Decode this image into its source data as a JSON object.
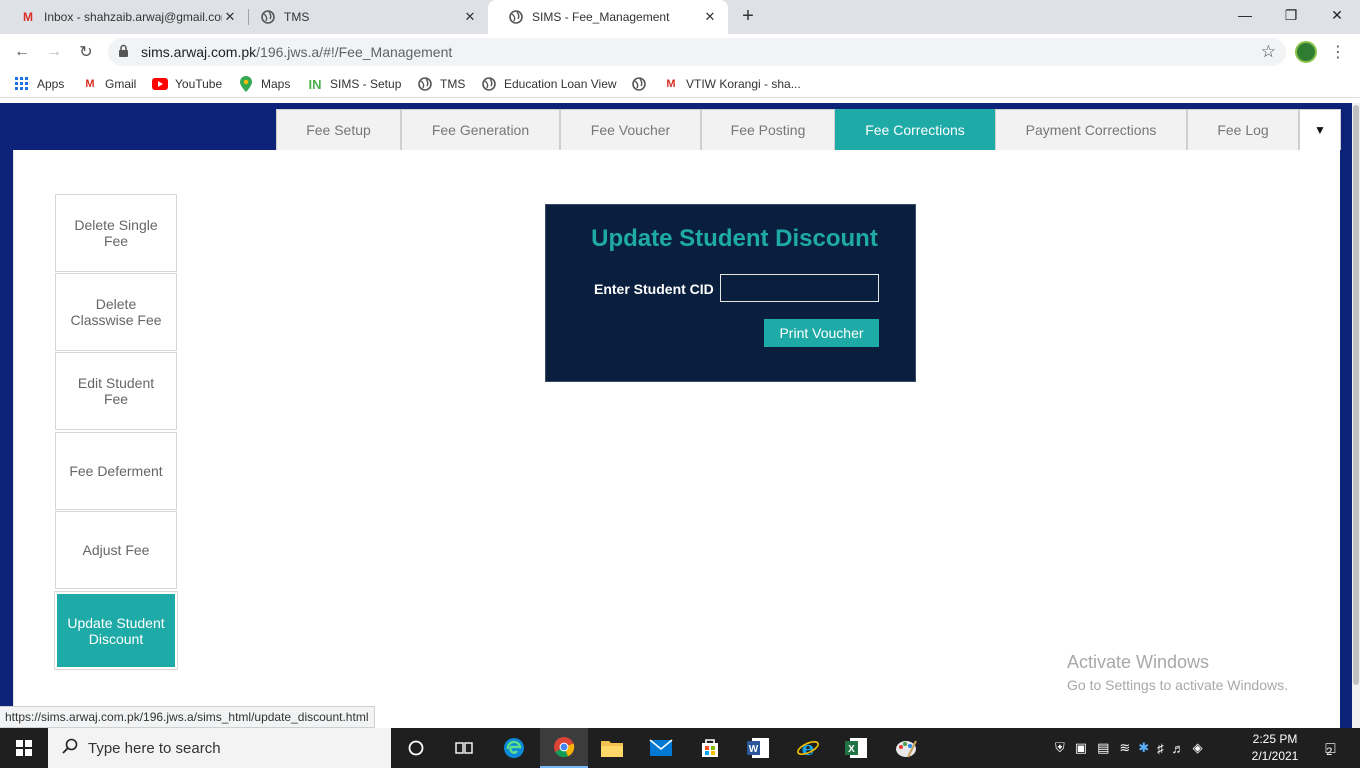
{
  "browser": {
    "tabs": [
      {
        "label": "Inbox - shahzaib.arwaj@gmail.com",
        "icon": "gmail-icon",
        "close": "✕"
      },
      {
        "label": "TMS",
        "icon": "globe-icon",
        "close": "✕"
      },
      {
        "label": "SIMS - Fee_Management",
        "icon": "globe-icon",
        "close": "✕"
      }
    ],
    "new_tab": "+",
    "url_host": "sims.arwaj.com.pk",
    "url_path": "/196.jws.a/#!/Fee_Management",
    "bookmarks": [
      "Apps",
      "Gmail",
      "YouTube",
      "Maps",
      "SIMS - Setup",
      "TMS",
      "Education Loan View",
      "VTIW Korangi - sha..."
    ]
  },
  "main_tabs": [
    "Fee Setup",
    "Fee Generation",
    "Fee Voucher",
    "Fee Posting",
    "Fee Corrections",
    "Payment Corrections",
    "Fee Log"
  ],
  "active_main_tab": "Fee Corrections",
  "sidebar": [
    "Delete Single Fee",
    "Delete Classwise Fee",
    "Edit Student Fee",
    "Fee Deferment",
    "Adjust Fee",
    "Update Student Discount"
  ],
  "active_sidebar": "Update Student Discount",
  "panel": {
    "title": "Update Student Discount",
    "cid_label": "Enter Student CID",
    "cid_value": "",
    "button": "Print Voucher"
  },
  "watermark": {
    "line1": "Activate Windows",
    "line2": "Go to Settings to activate Windows."
  },
  "status_url": "https://sims.arwaj.com.pk/196.jws.a/sims_html/update_discount.html",
  "taskbar": {
    "search_placeholder": "Type here to search",
    "time": "2:25 PM",
    "date": "2/1/2021",
    "notifications": "2"
  },
  "colors": {
    "header_blue": "#0d2279",
    "accent_teal": "#1eaaa6",
    "panel_navy": "#0a1f3d"
  }
}
